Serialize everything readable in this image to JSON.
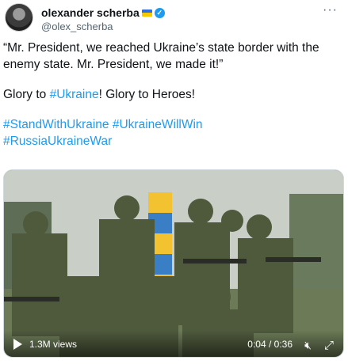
{
  "author": {
    "name": "olexander scherba",
    "handle": "@olex_scherba",
    "flag_colors": [
      "#2f6ee0",
      "#f5c800"
    ],
    "verified_icon": "verified-badge-icon",
    "more_label": "···"
  },
  "tweet": {
    "quote": "“Mr. President, we reached Ukraine’s state border with the enemy state.  Mr. President, we made it!”",
    "glory_prefix": "Glory to ",
    "glory_hashtag": "#Ukraine",
    "glory_suffix": "! Glory to Heroes!",
    "hashtags": [
      "#StandWithUkraine",
      "#UkraineWillWin",
      "#RussiaUkraineWar"
    ]
  },
  "video": {
    "views": "1.3M views",
    "time": "0:04 / 0:36",
    "icons": [
      "play-icon",
      "mute-icon",
      "fullscreen-icon"
    ]
  },
  "accent_color": "#1d9bf0"
}
